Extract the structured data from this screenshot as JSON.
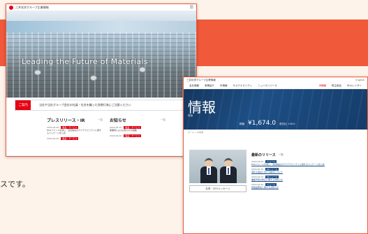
{
  "background": {
    "accent_color": "#f05a3a",
    "note_text": "スです。"
  },
  "window_a": {
    "header": {
      "site_name": "三井化学グループ企業情報"
    },
    "hero": {
      "title": "Leading the Future of Materials"
    },
    "notice": {
      "tag": "ご案内",
      "text": "当社や当社グループ会社の社員・社名を騙った詐欺行為にご注意ください"
    },
    "press": {
      "heading": "プレスリリース・IR",
      "more": "一覧",
      "items": [
        {
          "date": "2024.04.26",
          "tag": "製品・サービス",
          "text": "ESGファンドを通じ、当社株主のサステナビリティに関するパッケージを公表"
        },
        {
          "date": "2024.04.25",
          "tag": "製品・サービス",
          "text": ""
        }
      ]
    },
    "news": {
      "heading": "お知らせ",
      "more": "一覧",
      "items": [
        {
          "date": "2024.04.15",
          "tag": "製品・サービス",
          "text": "事業者によるお知らせの掲載"
        },
        {
          "date": "2024.04.20",
          "tag": "製品・サービス",
          "text": ""
        }
      ]
    }
  },
  "window_b": {
    "top": {
      "site_name": "三井化学グループ企業情報",
      "lang": "English"
    },
    "nav": {
      "left": [
        "会社情報",
        "事業紹介",
        "IR情報",
        "サステナビリティ",
        "ニュースリリース"
      ],
      "right": [
        "IR情報",
        "株主総会",
        "IRカレンダー"
      ]
    },
    "hero": {
      "title": "情報",
      "subtitle": "株価",
      "price_label": "株価",
      "price": "¥1,674.0",
      "change": "前日比 +20.0"
    },
    "breadcrumb": "ホーム > IR情報",
    "photo_button": "社長・CEOメッセージ",
    "news": {
      "heading": "最新のリリース",
      "more": "一覧",
      "items": [
        {
          "date": "2024.04.26",
          "tag": "ニュース",
          "text": "ESGファンドを通じ、当社株主のサステナビリティに関するパッケージを公表"
        },
        {
          "date": "2024.04.25",
          "tag": "IRニュース",
          "text": "海外子会社における取引について"
        },
        {
          "date": "2024.04.24",
          "tag": "IRニュース",
          "text": "業績予想の修正に関するお知らせ"
        },
        {
          "date": "2024.04.20",
          "tag": "ニュース",
          "text": "新製品発表に関するお知らせ"
        }
      ]
    }
  }
}
